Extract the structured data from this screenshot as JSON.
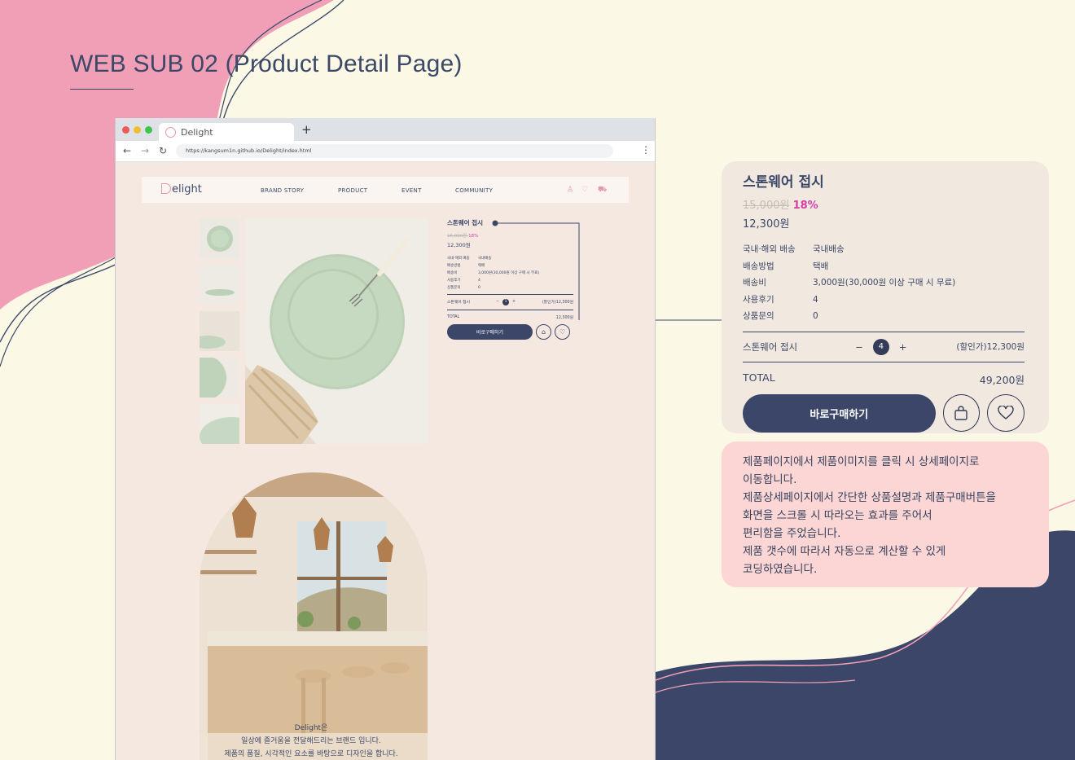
{
  "page_title": "WEB SUB 02 (Product Detail Page)",
  "colors": {
    "bg": "#fbf8e6",
    "pink_blob": "#f09fb6",
    "navy": "#3b4669",
    "accent_pink": "#d63fa8",
    "note_bg": "#fcd6d4",
    "panel_bg": "#f1e8df"
  },
  "browser": {
    "tab_title": "Delight",
    "url": "https://kangsum1n.github.io/Delight/index.html",
    "icons": [
      "back-arrow-icon",
      "forward-arrow-icon",
      "reload-icon",
      "kebab-menu-icon",
      "plus-icon"
    ]
  },
  "site": {
    "logo": "elight",
    "nav": [
      "BRAND STORY",
      "PRODUCT",
      "EVENT",
      "COMMUNITY"
    ],
    "header_icons": [
      "user-icon",
      "heart-icon",
      "cart-icon"
    ]
  },
  "product": {
    "name": "스톤웨어 접시",
    "old_price": "15,000원",
    "discount": "18%",
    "price": "12,300원",
    "info": [
      {
        "label": "국내·해외 배송",
        "value": "국내배송"
      },
      {
        "label": "배송방법",
        "value": "택배"
      },
      {
        "label": "배송비",
        "value": "3,000원(30,000원 이상 구매 시 무료)"
      },
      {
        "label": "사용후기",
        "value": "4"
      },
      {
        "label": "상품문의",
        "value": "0"
      }
    ],
    "option": {
      "name": "스톤웨어 접시",
      "minus": "−",
      "plus": "+",
      "sale_price": "(할인가)12,300원"
    },
    "mini_qty": "1",
    "mini_total": "12,300원",
    "zoom_qty": "4",
    "zoom_total": "49,200원",
    "total_label": "TOTAL",
    "buy_label": "바로구매하기"
  },
  "brand": {
    "lines": [
      "Delight은",
      "일상에 즐거움을 전달해드리는 브랜드 입니다.",
      "제품의 품질, 시각적인 요소를 바탕으로 디자인을 합니다."
    ]
  },
  "note": [
    "제품페이지에서 제품이미지를 클릭 시 상세페이지로",
    "이동합니다.",
    "제품상세페이지에서 간단한 상품설명과 제품구매버튼을",
    "화면을 스크롤 시 따라오는 효과를 주어서",
    "편리함을 주었습니다.",
    "제품 갯수에 따라서 자동으로 계산할 수 있게",
    "코딩하였습니다."
  ]
}
